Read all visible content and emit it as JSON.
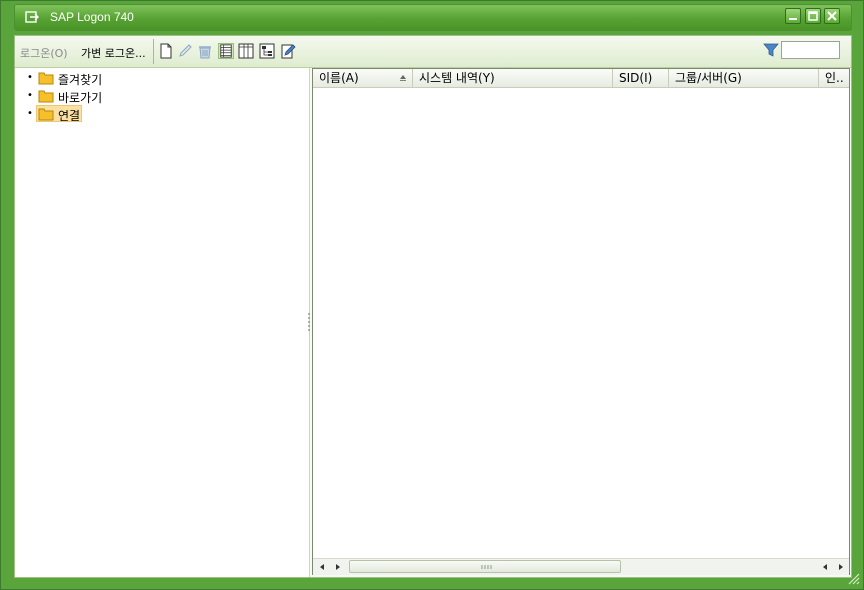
{
  "window": {
    "title": "SAP Logon 740",
    "colors": {
      "frame": "#5aa43c",
      "titlebar": "#57a233",
      "selection": "#fbe0a3"
    }
  },
  "toolbar": {
    "logon_label": "로그온(O)",
    "variable_logon_label": "가변 로그온...",
    "icons": [
      "new-item-icon",
      "edit-icon",
      "delete-icon",
      "list-view-icon",
      "column-view-icon",
      "tree-view-icon",
      "properties-icon"
    ],
    "filter_icon": "filter-icon",
    "filter_value": ""
  },
  "tree": {
    "items": [
      {
        "label": "즐겨찾기",
        "icon": "folder-icon",
        "selected": false
      },
      {
        "label": "바로가기",
        "icon": "folder-icon",
        "selected": false
      },
      {
        "label": "연결",
        "icon": "folder-icon",
        "selected": true
      }
    ]
  },
  "list": {
    "columns": [
      {
        "label": "이름(A)",
        "sorted": "ascending"
      },
      {
        "label": "시스템 내역(Y)"
      },
      {
        "label": "SID(I)"
      },
      {
        "label": "그룹/서버(G)"
      },
      {
        "label": "인.."
      }
    ],
    "rows": []
  }
}
